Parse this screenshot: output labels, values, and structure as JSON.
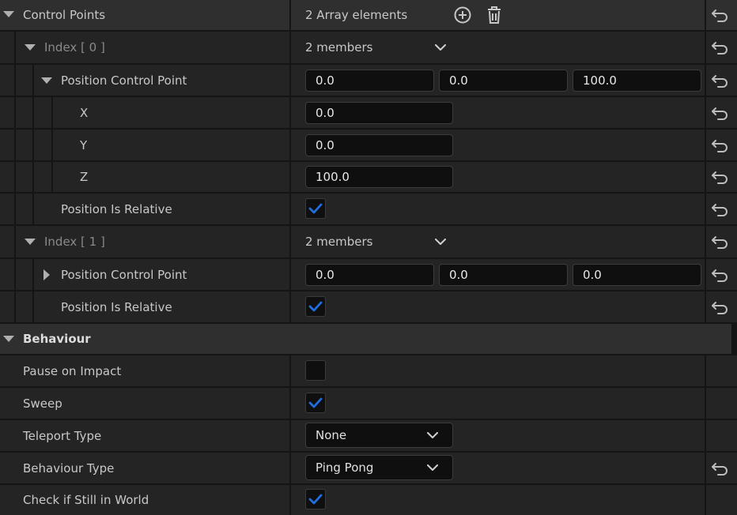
{
  "control_points": {
    "label": "Control Points",
    "value": "2 Array elements",
    "index0": {
      "label": "Index [ 0 ]",
      "members": "2 members",
      "position_label": "Position Control Point",
      "position": [
        "0.0",
        "0.0",
        "100.0"
      ],
      "x_label": "X",
      "x": "0.0",
      "y_label": "Y",
      "y": "0.0",
      "z_label": "Z",
      "z": "100.0",
      "relative_label": "Position Is Relative",
      "relative_checked": true
    },
    "index1": {
      "label": "Index [ 1 ]",
      "members": "2 members",
      "position_label": "Position Control Point",
      "position": [
        "0.0",
        "0.0",
        "0.0"
      ],
      "relative_label": "Position Is Relative",
      "relative_checked": true
    }
  },
  "behaviour": {
    "label": "Behaviour",
    "pause_on_impact": {
      "label": "Pause on Impact",
      "checked": false
    },
    "sweep": {
      "label": "Sweep",
      "checked": true
    },
    "teleport_type": {
      "label": "Teleport Type",
      "value": "None"
    },
    "behaviour_type": {
      "label": "Behaviour Type",
      "value": "Ping Pong"
    },
    "check_world": {
      "label": "Check if Still in World",
      "checked": true
    }
  },
  "colors": {
    "accent": "#1a6bd6",
    "row": "#242424",
    "header": "#2f2f2f"
  }
}
